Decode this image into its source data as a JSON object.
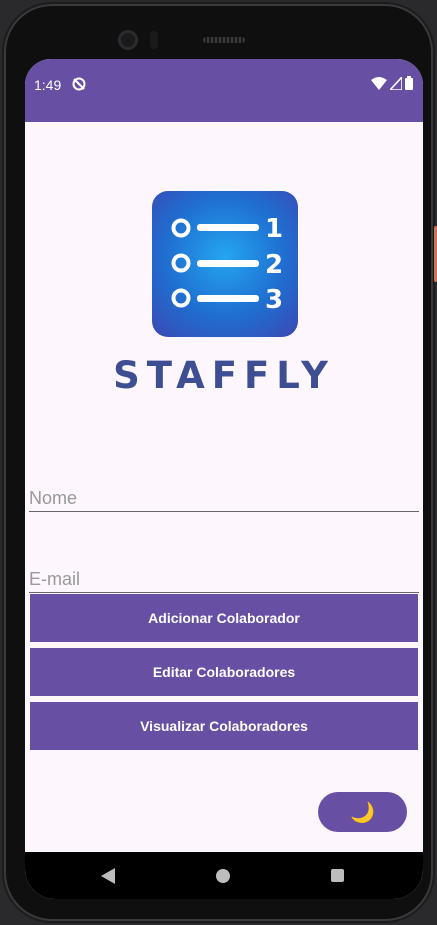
{
  "status_bar": {
    "time": "1:49",
    "sync_icon": "sync-off-icon",
    "wifi_icon": "wifi-icon",
    "signal_icon": "signal-icon",
    "battery_icon": "battery-icon",
    "color": "#6750a4"
  },
  "brand": {
    "logo_icon": "numbered-list-icon",
    "logo_numbers": [
      "1",
      "2",
      "3"
    ],
    "name": "STAFFLY"
  },
  "form": {
    "name_placeholder": "Nome",
    "name_value": "",
    "email_placeholder": "E-mail",
    "email_value": ""
  },
  "buttons": {
    "add_label": "Adicionar Colaborador",
    "edit_label": "Editar Colaboradores",
    "view_label": "Visualizar Colaboradores"
  },
  "theme_toggle": {
    "icon": "moon-icon",
    "glyph": "🌙"
  },
  "nav_bar": {
    "back_icon": "back-triangle-icon",
    "home_icon": "home-circle-icon",
    "recents_icon": "recents-square-icon"
  },
  "colors": {
    "accent": "#6750a4",
    "background": "#fdf6fd",
    "brand_text": "#3e4e92"
  }
}
